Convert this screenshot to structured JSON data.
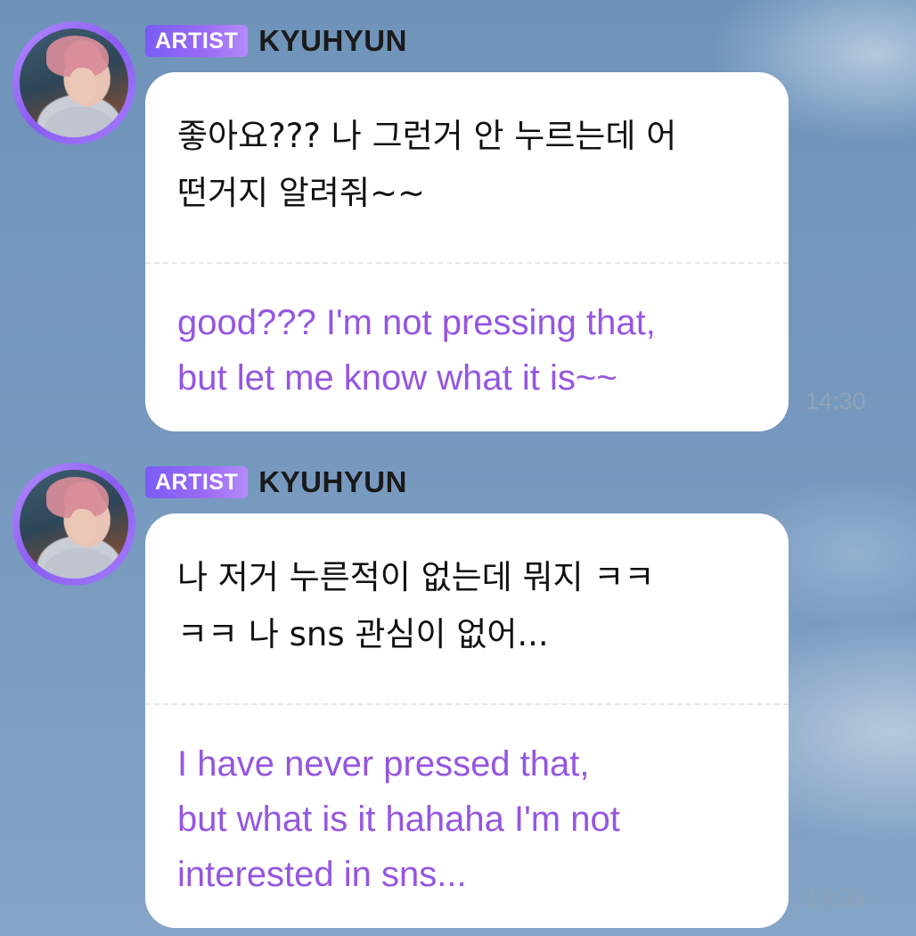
{
  "messages": [
    {
      "badge": "ARTIST",
      "sender": "KYUHYUN",
      "original_text": "좋아요??? 나 그런거 안 누르는데 어\n떤거지 알려줘~~",
      "translation": "good??? I'm not pressing that,\nbut let me know what it is~~",
      "time": "14:30"
    },
    {
      "badge": "ARTIST",
      "sender": "KYUHYUN",
      "original_text": "나 저거 누른적이 없는데 뭐지 ㅋㅋ\nㅋㅋ 나 sns 관심이 없어...",
      "translation": "I have never pressed that,\nbut what is it hahaha I'm not\ninterested in sns...",
      "time": "14:39"
    }
  ],
  "colors": {
    "badge": "#8a63f6",
    "translation_text": "#9556e0",
    "bubble": "#ffffff",
    "timestamp": "#8fa3b8"
  },
  "icons": {
    "avatar": "artist-profile-photo"
  }
}
